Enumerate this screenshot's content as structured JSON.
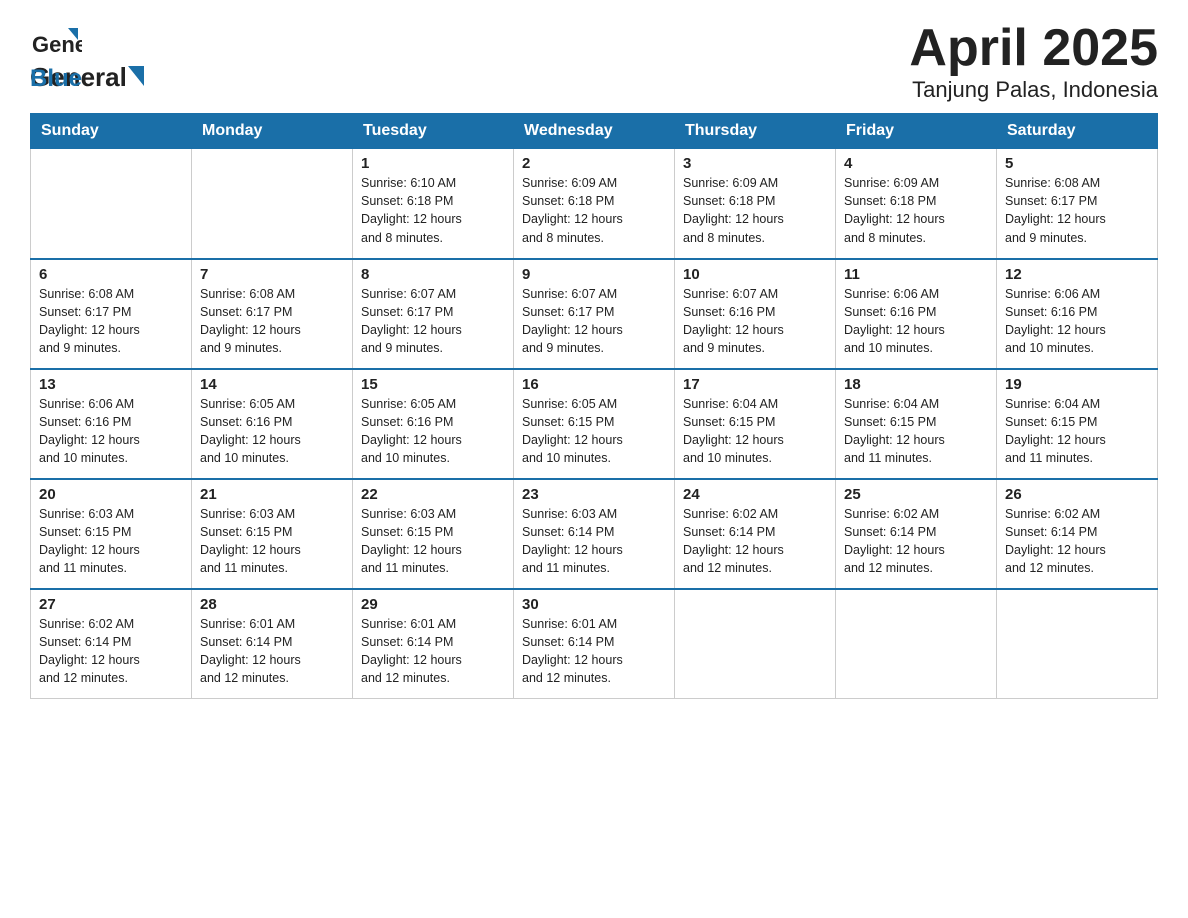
{
  "header": {
    "logo_general": "General",
    "logo_blue": "Blue",
    "title": "April 2025",
    "subtitle": "Tanjung Palas, Indonesia"
  },
  "calendar": {
    "days_of_week": [
      "Sunday",
      "Monday",
      "Tuesday",
      "Wednesday",
      "Thursday",
      "Friday",
      "Saturday"
    ],
    "weeks": [
      [
        {
          "day": "",
          "info": ""
        },
        {
          "day": "",
          "info": ""
        },
        {
          "day": "1",
          "info": "Sunrise: 6:10 AM\nSunset: 6:18 PM\nDaylight: 12 hours\nand 8 minutes."
        },
        {
          "day": "2",
          "info": "Sunrise: 6:09 AM\nSunset: 6:18 PM\nDaylight: 12 hours\nand 8 minutes."
        },
        {
          "day": "3",
          "info": "Sunrise: 6:09 AM\nSunset: 6:18 PM\nDaylight: 12 hours\nand 8 minutes."
        },
        {
          "day": "4",
          "info": "Sunrise: 6:09 AM\nSunset: 6:18 PM\nDaylight: 12 hours\nand 8 minutes."
        },
        {
          "day": "5",
          "info": "Sunrise: 6:08 AM\nSunset: 6:17 PM\nDaylight: 12 hours\nand 9 minutes."
        }
      ],
      [
        {
          "day": "6",
          "info": "Sunrise: 6:08 AM\nSunset: 6:17 PM\nDaylight: 12 hours\nand 9 minutes."
        },
        {
          "day": "7",
          "info": "Sunrise: 6:08 AM\nSunset: 6:17 PM\nDaylight: 12 hours\nand 9 minutes."
        },
        {
          "day": "8",
          "info": "Sunrise: 6:07 AM\nSunset: 6:17 PM\nDaylight: 12 hours\nand 9 minutes."
        },
        {
          "day": "9",
          "info": "Sunrise: 6:07 AM\nSunset: 6:17 PM\nDaylight: 12 hours\nand 9 minutes."
        },
        {
          "day": "10",
          "info": "Sunrise: 6:07 AM\nSunset: 6:16 PM\nDaylight: 12 hours\nand 9 minutes."
        },
        {
          "day": "11",
          "info": "Sunrise: 6:06 AM\nSunset: 6:16 PM\nDaylight: 12 hours\nand 10 minutes."
        },
        {
          "day": "12",
          "info": "Sunrise: 6:06 AM\nSunset: 6:16 PM\nDaylight: 12 hours\nand 10 minutes."
        }
      ],
      [
        {
          "day": "13",
          "info": "Sunrise: 6:06 AM\nSunset: 6:16 PM\nDaylight: 12 hours\nand 10 minutes."
        },
        {
          "day": "14",
          "info": "Sunrise: 6:05 AM\nSunset: 6:16 PM\nDaylight: 12 hours\nand 10 minutes."
        },
        {
          "day": "15",
          "info": "Sunrise: 6:05 AM\nSunset: 6:16 PM\nDaylight: 12 hours\nand 10 minutes."
        },
        {
          "day": "16",
          "info": "Sunrise: 6:05 AM\nSunset: 6:15 PM\nDaylight: 12 hours\nand 10 minutes."
        },
        {
          "day": "17",
          "info": "Sunrise: 6:04 AM\nSunset: 6:15 PM\nDaylight: 12 hours\nand 10 minutes."
        },
        {
          "day": "18",
          "info": "Sunrise: 6:04 AM\nSunset: 6:15 PM\nDaylight: 12 hours\nand 11 minutes."
        },
        {
          "day": "19",
          "info": "Sunrise: 6:04 AM\nSunset: 6:15 PM\nDaylight: 12 hours\nand 11 minutes."
        }
      ],
      [
        {
          "day": "20",
          "info": "Sunrise: 6:03 AM\nSunset: 6:15 PM\nDaylight: 12 hours\nand 11 minutes."
        },
        {
          "day": "21",
          "info": "Sunrise: 6:03 AM\nSunset: 6:15 PM\nDaylight: 12 hours\nand 11 minutes."
        },
        {
          "day": "22",
          "info": "Sunrise: 6:03 AM\nSunset: 6:15 PM\nDaylight: 12 hours\nand 11 minutes."
        },
        {
          "day": "23",
          "info": "Sunrise: 6:03 AM\nSunset: 6:14 PM\nDaylight: 12 hours\nand 11 minutes."
        },
        {
          "day": "24",
          "info": "Sunrise: 6:02 AM\nSunset: 6:14 PM\nDaylight: 12 hours\nand 12 minutes."
        },
        {
          "day": "25",
          "info": "Sunrise: 6:02 AM\nSunset: 6:14 PM\nDaylight: 12 hours\nand 12 minutes."
        },
        {
          "day": "26",
          "info": "Sunrise: 6:02 AM\nSunset: 6:14 PM\nDaylight: 12 hours\nand 12 minutes."
        }
      ],
      [
        {
          "day": "27",
          "info": "Sunrise: 6:02 AM\nSunset: 6:14 PM\nDaylight: 12 hours\nand 12 minutes."
        },
        {
          "day": "28",
          "info": "Sunrise: 6:01 AM\nSunset: 6:14 PM\nDaylight: 12 hours\nand 12 minutes."
        },
        {
          "day": "29",
          "info": "Sunrise: 6:01 AM\nSunset: 6:14 PM\nDaylight: 12 hours\nand 12 minutes."
        },
        {
          "day": "30",
          "info": "Sunrise: 6:01 AM\nSunset: 6:14 PM\nDaylight: 12 hours\nand 12 minutes."
        },
        {
          "day": "",
          "info": ""
        },
        {
          "day": "",
          "info": ""
        },
        {
          "day": "",
          "info": ""
        }
      ]
    ]
  }
}
